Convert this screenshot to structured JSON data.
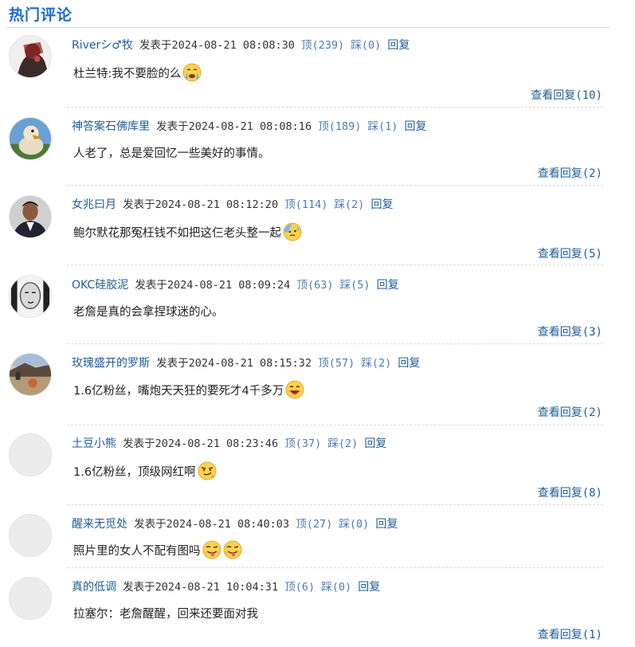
{
  "section_title": "热门评论",
  "labels": {
    "posted_at": "发表于",
    "up": "顶",
    "down": "踩",
    "reply": "回复",
    "view_replies": "查看回复"
  },
  "comments": [
    {
      "user": "Riverシ♂牧",
      "time": "2024-08-21 08:08:30",
      "up": "(239)",
      "down": "(0)",
      "text": "杜兰特:我不要脸的么",
      "emojis": [
        "crying"
      ],
      "replies": "(10)"
    },
    {
      "user": "神答案石佛库里",
      "time": "2024-08-21 08:08:16",
      "up": "(189)",
      "down": "(1)",
      "text": "人老了，总是爱回忆一些美好的事情。",
      "emojis": [],
      "replies": "(2)"
    },
    {
      "user": "女兆曰月",
      "time": "2024-08-21 08:12:20",
      "up": "(114)",
      "down": "(2)",
      "text": "鲍尔默花那冤枉钱不如把这仨老头整一起",
      "emojis": [
        "sweat"
      ],
      "replies": "(5)"
    },
    {
      "user": "OKC硅胶泥",
      "time": "2024-08-21 08:09:24",
      "up": "(63)",
      "down": "(5)",
      "text": "老詹是真的会拿捏球迷的心。",
      "emojis": [],
      "replies": "(3)"
    },
    {
      "user": "玫瑰盛开的罗斯",
      "time": "2024-08-21 08:15:32",
      "up": "(57)",
      "down": "(2)",
      "text": "1.6亿粉丝，嘴炮天天狂的要死才4千多万",
      "emojis": [
        "grin"
      ],
      "replies": "(2)"
    },
    {
      "user": "土豆小熊",
      "time": "2024-08-21 08:23:46",
      "up": "(37)",
      "down": "(2)",
      "text": "1.6亿粉丝，顶级网红啊",
      "emojis": [
        "smirk"
      ],
      "replies": "(8)"
    },
    {
      "user": "醒来无觅处",
      "time": "2024-08-21 08:40:03",
      "up": "(27)",
      "down": "(0)",
      "text": "照片里的女人不配有图吗",
      "emojis": [
        "tongue",
        "tongue"
      ],
      "replies": "(1)"
    },
    {
      "user": "真的低调",
      "time": "2024-08-21 10:04:31",
      "up": "(6)",
      "down": "(0)",
      "text": "拉塞尔：老詹醒醒，回来还要面对我",
      "emojis": [],
      "replies": "(1)"
    }
  ]
}
